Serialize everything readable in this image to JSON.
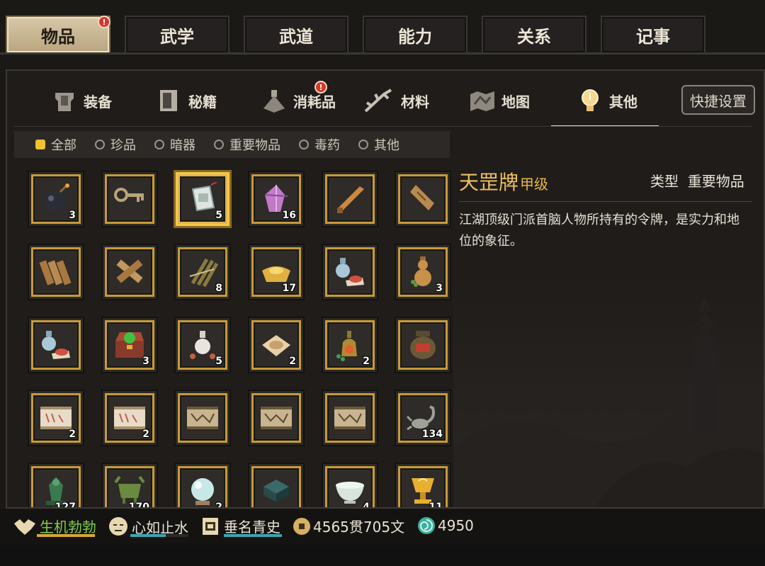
{
  "top_tabs": [
    {
      "label": "物品",
      "badge": "!"
    },
    {
      "label": "武学"
    },
    {
      "label": "武道"
    },
    {
      "label": "能力"
    },
    {
      "label": "关系"
    },
    {
      "label": "记事"
    }
  ],
  "sub_tabs": [
    {
      "label": "装备",
      "icon": "armor-icon"
    },
    {
      "label": "秘籍",
      "icon": "book-icon"
    },
    {
      "label": "消耗品",
      "icon": "potion-icon",
      "badge": "!"
    },
    {
      "label": "材料",
      "icon": "ginseng-icon"
    },
    {
      "label": "地图",
      "icon": "map-icon"
    },
    {
      "label": "其他",
      "icon": "lightbulb-icon"
    }
  ],
  "quick_settings": "快捷设置",
  "filters": [
    {
      "label": "全部",
      "selected": true
    },
    {
      "label": "珍品"
    },
    {
      "label": "暗器"
    },
    {
      "label": "重要物品"
    },
    {
      "label": "毒药"
    },
    {
      "label": "其他"
    }
  ],
  "items": [
    {
      "icon": "bomb-icon",
      "count": "3"
    },
    {
      "icon": "key-icon",
      "count": ""
    },
    {
      "icon": "token-plaque-icon",
      "count": "5",
      "selected": true
    },
    {
      "icon": "crystal-icon",
      "count": "16"
    },
    {
      "icon": "wooden-sword-icon",
      "count": ""
    },
    {
      "icon": "wood-log-icon",
      "count": ""
    },
    {
      "icon": "wood-planks-icon",
      "count": ""
    },
    {
      "icon": "crossed-logs-icon",
      "count": ""
    },
    {
      "icon": "bamboo-bundle-icon",
      "count": "8"
    },
    {
      "icon": "gold-ingot-icon",
      "count": "17"
    },
    {
      "icon": "vase-powder-icon",
      "count": ""
    },
    {
      "icon": "gourd-vase-icon",
      "count": "3"
    },
    {
      "icon": "vase-powder-icon",
      "count": ""
    },
    {
      "icon": "treasure-chest-icon",
      "count": "3"
    },
    {
      "icon": "flask-icon",
      "count": "5"
    },
    {
      "icon": "powder-packet-icon",
      "count": "2"
    },
    {
      "icon": "green-bottle-icon",
      "count": "2"
    },
    {
      "icon": "wine-jar-icon",
      "count": ""
    },
    {
      "icon": "scroll-icon",
      "count": "2"
    },
    {
      "icon": "scroll-icon",
      "count": "2"
    },
    {
      "icon": "map-scroll-icon",
      "count": ""
    },
    {
      "icon": "map-scroll-icon",
      "count": ""
    },
    {
      "icon": "map-scroll-icon",
      "count": ""
    },
    {
      "icon": "scorpion-icon",
      "count": "134"
    },
    {
      "icon": "jade-figure-icon",
      "count": "127"
    },
    {
      "icon": "bronze-vessel-icon",
      "count": "170"
    },
    {
      "icon": "pearl-icon",
      "count": "2"
    },
    {
      "icon": "stone-slab-icon",
      "count": ""
    },
    {
      "icon": "bowl-icon",
      "count": "4"
    },
    {
      "icon": "golden-cup-icon",
      "count": "11"
    }
  ],
  "detail": {
    "name": "天罡牌",
    "grade": "甲级",
    "type_label": "类型",
    "type_value": "重要物品",
    "description": "江湖顶级门派首脑人物所持有的令牌，是实力和地位的象征。"
  },
  "status": {
    "health": "生机勃勃",
    "mood": "心如止水",
    "fame": "垂名青史",
    "money": "4565贯705文",
    "points": "4950"
  },
  "colors": {
    "gold": "#c79a3a",
    "title": "#f0c060",
    "health_bar": "#d8a73a",
    "mood_bar": "#3aa5b5",
    "fame_bar": "#3aa5b5"
  }
}
